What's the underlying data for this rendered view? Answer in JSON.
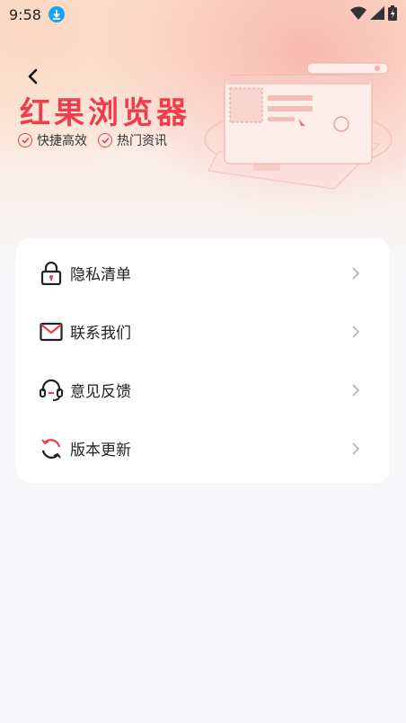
{
  "status_bar": {
    "time": "9:58"
  },
  "header": {
    "brand_title": "红果浏览器",
    "tags": [
      "快捷高效",
      "热门资讯"
    ]
  },
  "menu": [
    {
      "label": "隐私清单",
      "icon": "lock-icon"
    },
    {
      "label": "联系我们",
      "icon": "mail-icon"
    },
    {
      "label": "意见反馈",
      "icon": "headset-icon"
    },
    {
      "label": "版本更新",
      "icon": "refresh-icon"
    }
  ],
  "colors": {
    "accent": "#ee3d4c",
    "text": "#222222",
    "card_bg": "#ffffff",
    "page_bg": "#f6f6f8"
  }
}
